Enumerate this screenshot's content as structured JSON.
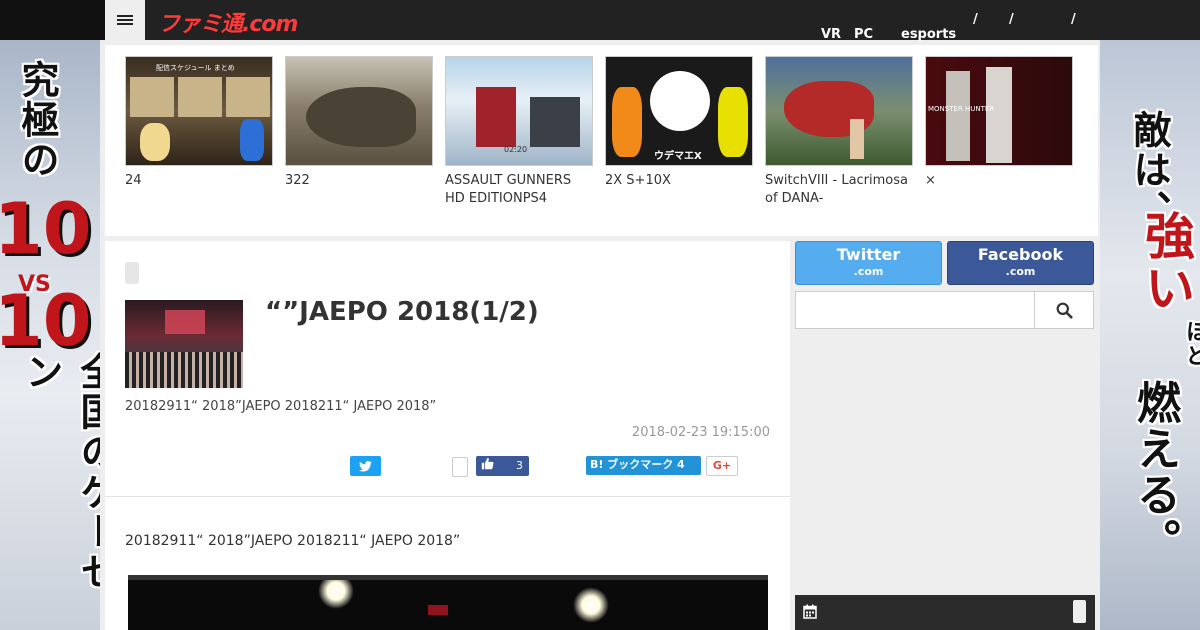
{
  "header": {
    "logo": "ファミ通.com",
    "nav": [
      "VR",
      "PC",
      "esports",
      "/",
      "/",
      "/"
    ]
  },
  "ads": {
    "left": {
      "line1": "究極の",
      "line2": "10",
      "line3": "VS",
      "line4": "10",
      "line5": "全国のゲーセン"
    },
    "right": {
      "line1": "敵は、",
      "line2": "強い",
      "line3": "ほど",
      "line4": "燃える。"
    }
  },
  "carousel": {
    "items": [
      {
        "caption": "24"
      },
      {
        "caption": "322"
      },
      {
        "caption": "ASSAULT GUNNERS HD EDITIONPS4"
      },
      {
        "caption": "2X S+10X"
      },
      {
        "caption": "SwitchVIII - Lacrimosa of DANA-"
      },
      {
        "caption": "×"
      }
    ],
    "thumb_texts": {
      "schedule": "配信スケジュール まとめ",
      "gunners": "02:20",
      "splat": "ウデマエX",
      "mh": "MONSTER HUNTER"
    }
  },
  "article": {
    "title": "“”JAEPO 2018(1/2)",
    "lead": "20182911“  2018”JAEPO 2018211“ JAEPO 2018”",
    "date": "2018-02-23 19:15:00",
    "body": "20182911“  2018”JAEPO 2018211“ JAEPO 2018”",
    "share": {
      "fb_count": "3",
      "hatena_label": "B! ブックマーク 4",
      "gplus_label": "G+"
    }
  },
  "sidebar": {
    "twitter": {
      "main": "Twitter",
      "sub": ".com"
    },
    "facebook": {
      "main": "Facebook",
      "sub": ".com"
    },
    "search_placeholder": ""
  },
  "colors": {
    "twitter": "#55acee",
    "facebook": "#3b5998",
    "hatena": "#2293d6",
    "logo": "#ff3a3a"
  }
}
